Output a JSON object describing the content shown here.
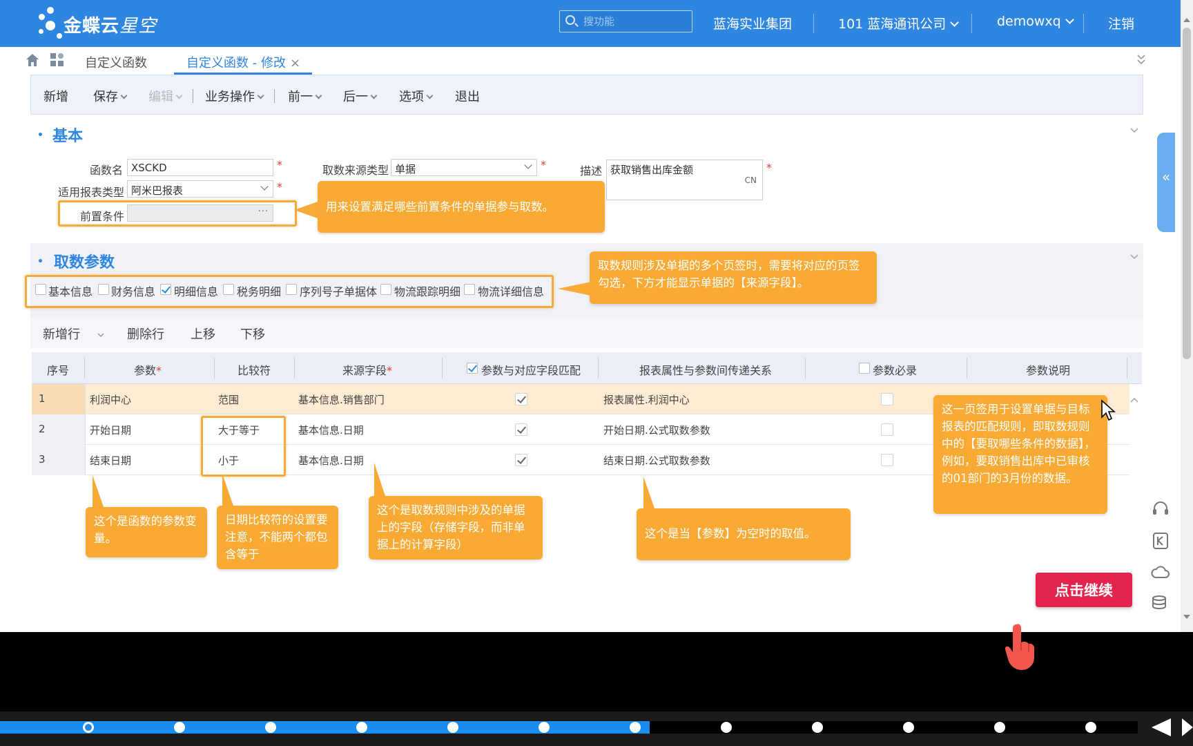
{
  "header": {
    "logo_main": "金蝶云",
    "logo_sub": "星空",
    "search_placeholder": "搜功能",
    "org_group": "蓝海实业集团",
    "company": "101 蓝海通讯公司",
    "user": "demowxq",
    "logout": "注销"
  },
  "tabs": [
    {
      "label": "自定义函数"
    },
    {
      "label": "自定义函数 - 修改"
    }
  ],
  "toolbar": {
    "add": "新增",
    "save": "保存",
    "edit": "编辑",
    "business": "业务操作",
    "prev": "前一",
    "next": "后一",
    "options": "选项",
    "exit": "退出"
  },
  "basic": {
    "title": "基本",
    "fn_name_label": "函数名",
    "fn_name_value": "XSCKD",
    "source_type_label": "取数来源类型",
    "source_type_value": "单据",
    "desc_label": "描述",
    "desc_value": "获取销售出库金额",
    "desc_lang": "CN",
    "report_type_label": "适用报表类型",
    "report_type_value": "阿米巴报表",
    "precondition_label": "前置条件",
    "precondition_btn": "···"
  },
  "params": {
    "title": "取数参数",
    "tabs": [
      {
        "label": "基本信息",
        "checked": false
      },
      {
        "label": "财务信息",
        "checked": false
      },
      {
        "label": "明细信息",
        "checked": true
      },
      {
        "label": "税务明细",
        "checked": false
      },
      {
        "label": "序列号子单据体",
        "checked": false
      },
      {
        "label": "物流跟踪明细",
        "checked": false
      },
      {
        "label": "物流详细信息",
        "checked": false
      }
    ]
  },
  "grid": {
    "add_row": "新增行",
    "delete_row": "删除行",
    "move_up": "上移",
    "move_down": "下移",
    "columns": {
      "seq": "序号",
      "param": "参数",
      "req_mark": "*",
      "compare": "比较符",
      "source_field": "来源字段",
      "match": "参数与对应字段匹配",
      "relation": "报表属性与参数间传递关系",
      "required": "参数必录",
      "desc": "参数说明"
    },
    "rows": [
      {
        "seq": "1",
        "param": "利润中心",
        "compare": "范围",
        "source": "基本信息.销售部门",
        "match": true,
        "relation": "报表属性.利润中心",
        "required": false
      },
      {
        "seq": "2",
        "param": "开始日期",
        "compare": "大于等于",
        "source": "基本信息.日期",
        "match": true,
        "relation": "开始日期.公式取数参数",
        "required": false
      },
      {
        "seq": "3",
        "param": "结束日期",
        "compare": "小于",
        "source": "基本信息.日期",
        "match": true,
        "relation": "结束日期.公式取数参数",
        "required": false
      }
    ]
  },
  "callouts": {
    "precondition": "用来设置满足哪些前置条件的单据参与取数。",
    "tabs": "取数规则涉及单据的多个页签时，需要将对应的页签勾选，下方才能显示单据的【来源字段】。",
    "param": "这个是函数的参数变量。",
    "compare": "日期比较符的设置要注意，不能两个都包含等于",
    "source": "这个是取数规则中涉及的单据上的字段（存储字段，而非单据上的计算字段）",
    "relation": "这个是当【参数】为空时的取值。",
    "match": "这一页签用于设置单据与目标报表的匹配规则，即取数规则中的【要取哪些条件的数据】，例如，要取销售出库中已审核的01部门的3月份的数据。"
  },
  "continue_label": "点击继续",
  "side_tab_label": "«",
  "player": {
    "progress": 0.571,
    "markers": 12
  }
}
